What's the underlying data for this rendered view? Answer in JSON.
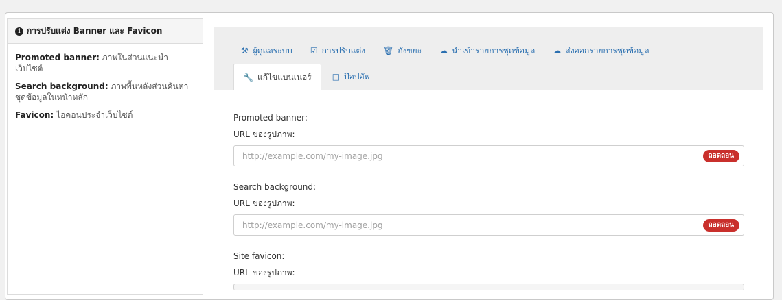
{
  "sidebar": {
    "title": "การปรับแต่ง Banner และ Favicon",
    "entries": [
      {
        "key": "Promoted banner:",
        "desc": " ภาพในส่วนแนะนำเว็บไซต์"
      },
      {
        "key": "Search background:",
        "desc": " ภาพพื้นหลังส่วนค้นหาชุดข้อมูลในหน้าหลัก"
      },
      {
        "key": "Favicon:",
        "desc": " ไอคอนประจำเว็บไซต์"
      }
    ]
  },
  "tabs": {
    "row1": [
      {
        "label": "ผู้ดูแลระบบ",
        "icon": "gavel-icon"
      },
      {
        "label": "การปรับแต่ง",
        "icon": "checkbox-edit-icon"
      },
      {
        "label": "ถังขยะ",
        "icon": "trash-icon"
      },
      {
        "label": "นำเข้ารายการชุดข้อมูล",
        "icon": "cloud-upload-icon"
      },
      {
        "label": "ส่งออกรายการชุดข้อมูล",
        "icon": "cloud-download-icon"
      }
    ],
    "row2": [
      {
        "label": "แก้ไขแบนเนอร์",
        "icon": "wrench-icon",
        "active": true
      },
      {
        "label": "ป๊อปอัพ",
        "icon": "window-icon",
        "active": false
      }
    ]
  },
  "form": {
    "sections": [
      {
        "title": "Promoted banner:",
        "url_label": "URL ของรูปภาพ:",
        "placeholder": "http://example.com/my-image.jpg",
        "remove_label": "ถอดถอน"
      },
      {
        "title": "Search background:",
        "url_label": "URL ของรูปภาพ:",
        "placeholder": "http://example.com/my-image.jpg",
        "remove_label": "ถอดถอน"
      },
      {
        "title": "Site favicon:",
        "url_label": "URL ของรูปภาพ:"
      }
    ]
  },
  "colors": {
    "link": "#2a6fb0",
    "danger": "#c9302c"
  }
}
